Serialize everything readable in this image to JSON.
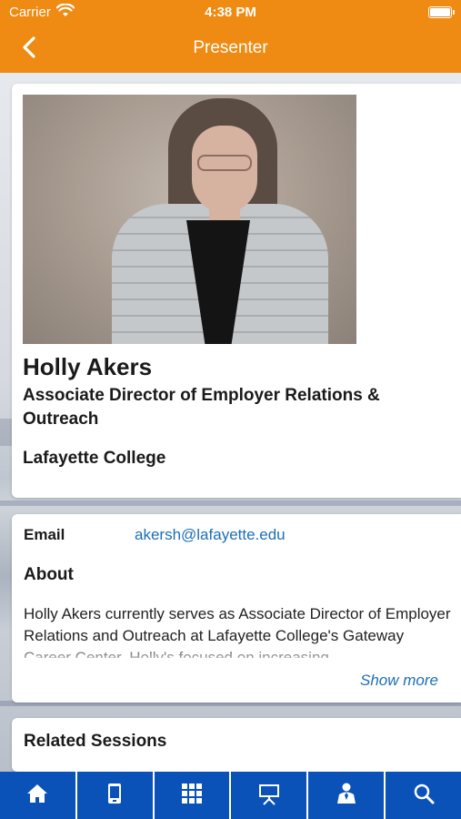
{
  "status_bar": {
    "carrier": "Carrier",
    "time": "4:38 PM"
  },
  "nav": {
    "title": "Presenter"
  },
  "profile": {
    "name": "Holly Akers",
    "title": "Associate Director of Employer Relations & Outreach",
    "organization": "Lafayette College"
  },
  "details": {
    "email_label": "Email",
    "email_value": "akersh@lafayette.edu",
    "about_heading": "About",
    "about_text": "Holly Akers currently serves as Associate Director of Employer Relations and Outreach at Lafayette College's Gateway Career Center. Holly's focused on increasing",
    "show_more": "Show more"
  },
  "related": {
    "heading": "Related Sessions"
  },
  "tabs": [
    {
      "icon": "home-icon"
    },
    {
      "icon": "mobile-device-icon"
    },
    {
      "icon": "grid-icon"
    },
    {
      "icon": "presentation-board-icon"
    },
    {
      "icon": "presenter-person-icon"
    },
    {
      "icon": "search-icon"
    }
  ],
  "colors": {
    "header": "#ef8a12",
    "tab_bar": "#0a52b8",
    "link": "#1d6fb8"
  }
}
